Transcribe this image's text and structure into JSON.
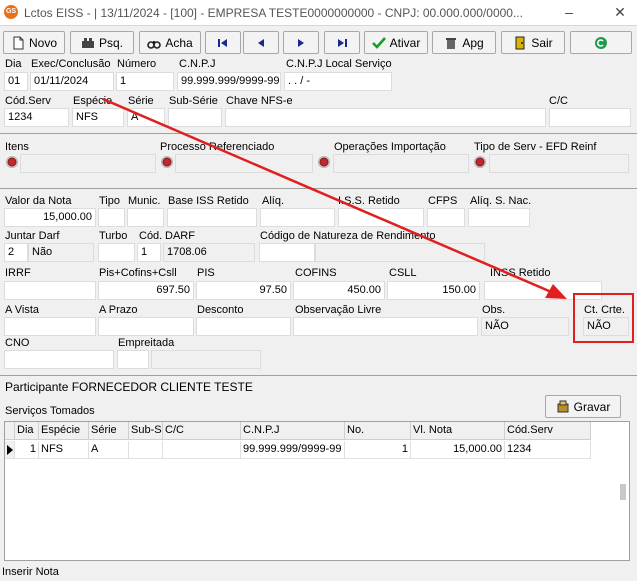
{
  "window": {
    "icon": "GS",
    "title": "Lctos EISS - |  13/11/2024 - [100] - EMPRESA TESTE0000000000 - CNPJ: 00.000.000/0000...",
    "minimize": "–",
    "close": "✕"
  },
  "toolbar": {
    "novo": "Novo",
    "psq": "Psq.",
    "acha": "Acha",
    "ativar": "Ativar",
    "apg": "Apg",
    "sair": "Sair"
  },
  "form": {
    "dia": {
      "label": "Dia",
      "value": "01"
    },
    "exec": {
      "label": "Exec/Conclusão",
      "value": "01/11/2024"
    },
    "numero": {
      "label": "Número",
      "value": "1"
    },
    "cnpj": {
      "label": "C.N.P.J",
      "value": "99.999.999/9999-99"
    },
    "cnpj_local": {
      "label": "C.N.P.J Local Serviço",
      "value": " .   .   /    -"
    },
    "cod_serv": {
      "label": "Cód.Serv",
      "value": "1234"
    },
    "especie": {
      "label": "Espécie",
      "value": "NFS"
    },
    "serie": {
      "label": "Série",
      "value": "A"
    },
    "sub_serie": {
      "label": "Sub-Série",
      "value": ""
    },
    "chave_nfse": {
      "label": "Chave NFS-e",
      "value": ""
    },
    "cc": {
      "label": "C/C",
      "value": ""
    },
    "itens": {
      "label": "Itens"
    },
    "processo_ref": {
      "label": "Processo Referenciado"
    },
    "operacoes_imp": {
      "label": "Operações Importação"
    },
    "tipo_serv": {
      "label": "Tipo de Serv - EFD Reinf"
    },
    "valor_nota": {
      "label": "Valor da Nota",
      "value": "15,000.00"
    },
    "tipo": {
      "label": "Tipo",
      "value": ""
    },
    "munic": {
      "label": "Munic.",
      "value": ""
    },
    "base_iss": {
      "label": "Base ISS Retido",
      "value": ""
    },
    "aliq": {
      "label": "Alíq.",
      "value": ""
    },
    "iss_retido": {
      "label": "I.S.S. Retido",
      "value": ""
    },
    "cfps": {
      "label": "CFPS",
      "value": ""
    },
    "aliq_s_nac": {
      "label": "Alíq. S. Nac.",
      "value": ""
    },
    "juntar_darf": {
      "label": "Juntar Darf",
      "code": "2",
      "value": "Não"
    },
    "turbo": {
      "label": "Turbo",
      "value": ""
    },
    "cod": {
      "label": "Cód.",
      "value": "1"
    },
    "darf": {
      "label": "DARF",
      "value": "1708.06"
    },
    "cod_natureza": {
      "label": "Código de Natureza de Rendimento",
      "value": ""
    },
    "irrf": {
      "label": "IRRF",
      "value": ""
    },
    "pis_cofins_csll": {
      "label": "Pis+Cofins+Csll",
      "value": "697.50"
    },
    "pis": {
      "label": "PIS",
      "value": "97.50"
    },
    "cofins": {
      "label": "COFINS",
      "value": "450.00"
    },
    "csll": {
      "label": "CSLL",
      "value": "150.00"
    },
    "inss_retido": {
      "label": "INSS Retido",
      "value": ""
    },
    "a_vista": {
      "label": "A Vista",
      "value": ""
    },
    "a_prazo": {
      "label": "A Prazo",
      "value": ""
    },
    "desconto": {
      "label": "Desconto",
      "value": ""
    },
    "observacao_livre": {
      "label": "Observação Livre",
      "value": ""
    },
    "obs": {
      "label": "Obs.",
      "value": "NÃO"
    },
    "ct_crte": {
      "label": "Ct. Crte.",
      "value": "NÃO"
    },
    "cno": {
      "label": "CNO",
      "value": ""
    },
    "empreitada": {
      "label": "Empreitada",
      "value": ""
    }
  },
  "participante": "Participante FORNECEDOR CLIENTE TESTE",
  "servicos": {
    "title": "Serviços Tomados",
    "gravar": "Gravar",
    "columns": [
      "Dia",
      "Espécie",
      "Série",
      "Sub-S",
      "C/C",
      "C.N.P.J",
      "No.",
      "Vl. Nota",
      "Cód.Serv"
    ],
    "rows": [
      {
        "dia": "1",
        "especie": "NFS",
        "serie": "A",
        "subs": "",
        "cc": "",
        "cnpj": "99.999.999/9999-99",
        "no": "1",
        "vl_nota": "15,000.00",
        "cod_serv": "1234"
      }
    ]
  },
  "status": "Inserir Nota",
  "colors": {
    "highlight": "#e02020",
    "arrow": "#e02020"
  }
}
